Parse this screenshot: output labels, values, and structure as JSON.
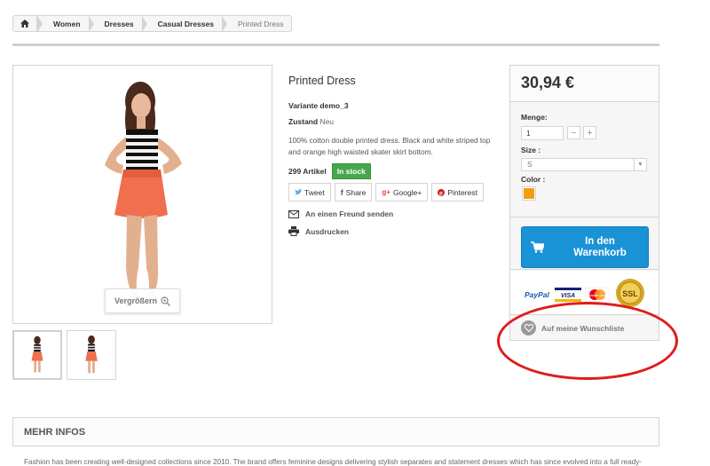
{
  "breadcrumb": {
    "items": [
      "Women",
      "Dresses",
      "Casual Dresses",
      "Printed Dress"
    ]
  },
  "image": {
    "zoom_label": "Vergrößern"
  },
  "product": {
    "title": "Printed Dress",
    "reference": "Variante demo_3",
    "condition_label": "Zustand",
    "condition_value": "Neu",
    "description": "100% cotton double printed dress. Black and white striped top and orange high waisted skater skirt bottom.",
    "quantity_text": "299 Artikel",
    "stock_badge": "In stock",
    "share": [
      "Tweet",
      "Share",
      "Google+",
      "Pinterest"
    ],
    "send_friend": "An einen Freund senden",
    "print": "Ausdrucken"
  },
  "buy": {
    "price": "30,94 €",
    "qty_label": "Menge:",
    "qty_value": "1",
    "size_label": "Size :",
    "size_value": "S",
    "color_label": "Color :",
    "color_hex": "#f39c11",
    "cart_line1": "In den",
    "cart_line2": "Warenkorb",
    "payment": [
      "PayPal",
      "VISA",
      "MasterCard",
      "SSL"
    ],
    "wishlist": "Auf meine Wunschliste"
  },
  "more_info": {
    "title": "MEHR INFOS",
    "text": "Fashion has been creating well-designed collections since 2010. The brand offers feminine designs delivering stylish separates and statement dresses which has since evolved into a full ready-"
  },
  "colors": {
    "accent_blue": "#1a93d6",
    "stock_green": "#46a74e",
    "annotation_red": "#e01b1b"
  }
}
